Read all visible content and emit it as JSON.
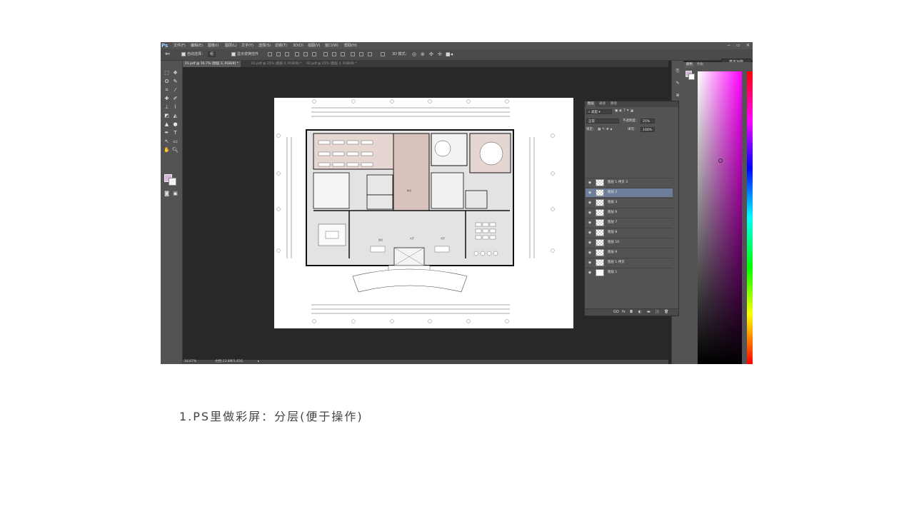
{
  "app": {
    "logo": "Ps",
    "menus": [
      "文件(F)",
      "编辑(E)",
      "图像(I)",
      "图层(L)",
      "文字(Y)",
      "选择(S)",
      "滤镜(T)",
      "3D(D)",
      "视图(V)",
      "窗口(W)",
      "帮助(H)"
    ],
    "window_buttons": [
      "−",
      "▭",
      "✕"
    ]
  },
  "options_bar": {
    "auto_select_label": "自动选择：",
    "auto_select_value": "组",
    "transform_label": "显示变换控件",
    "mode_3d_label": "3D 模式：",
    "workspace": "基本功能"
  },
  "tabs": [
    {
      "label": "01.pdf @ 16.7% (图层 3, RGB/8) *",
      "active": true
    },
    {
      "label": "01.pdf @ 25% (图层 4, RGB/8) *",
      "active": false
    },
    {
      "label": "02.pdf @ 25% (图层 4, RGB/8) *",
      "active": false
    }
  ],
  "status": {
    "zoom": "16.67%",
    "doc": "文档:23.8M/1.65G"
  },
  "layers_panel": {
    "tabs": [
      "图层",
      "通道",
      "路径"
    ],
    "filter_label": "类型",
    "blend_mode": "正常",
    "opacity_label": "不透明度：",
    "opacity_value": "25%",
    "lock_label": "锁定：",
    "fill_label": "填充：",
    "fill_value": "100%",
    "layers": [
      {
        "name": "图层 1 拷贝 3",
        "selected": false
      },
      {
        "name": "图层 2",
        "selected": true
      },
      {
        "name": "图层 3",
        "selected": false
      },
      {
        "name": "图层 6",
        "selected": false
      },
      {
        "name": "图层 7",
        "selected": false
      },
      {
        "name": "图层 8",
        "selected": false
      },
      {
        "name": "图层 10",
        "selected": false
      },
      {
        "name": "图层 9",
        "selected": false
      },
      {
        "name": "图层 1 拷贝",
        "selected": false
      },
      {
        "name": "图层 1",
        "selected": false
      }
    ],
    "bottom_icons": [
      "GO",
      "fx",
      "◘",
      "◐",
      "▬",
      "◳",
      "🗑"
    ]
  },
  "color_panel": {
    "tabs": [
      "颜色",
      "色板"
    ],
    "fg": "#d5b6da",
    "bg": "#ffffff"
  },
  "plan_labels": {
    "left": [
      "会议",
      "休息"
    ],
    "center": [
      "大厅"
    ],
    "right": [
      "大厅"
    ]
  },
  "caption": "1.PS里做彩屏：分层(便于操作)"
}
